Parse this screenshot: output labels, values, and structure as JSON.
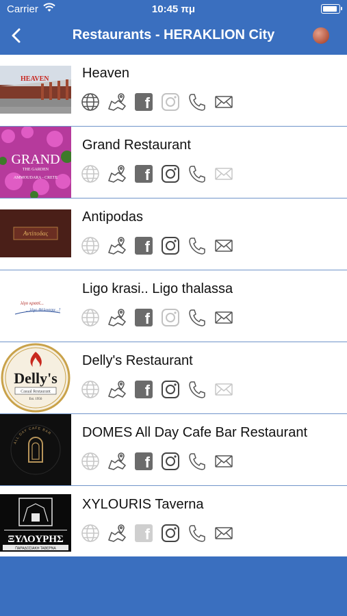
{
  "status": {
    "carrier": "Carrier",
    "time": "10:45 πμ"
  },
  "nav": {
    "title": "Restaurants - HERAKLION City"
  },
  "restaurants": [
    {
      "name": "Heaven",
      "thumb_text": "HEAVEN",
      "web": true,
      "map": true,
      "facebook": true,
      "instagram": false,
      "phone": true,
      "email": true
    },
    {
      "name": "Grand Restaurant",
      "thumb_text": "GRAND",
      "thumb_sub": "THE GARDEN",
      "thumb_sub2": "AMMOUDARA - CRETE",
      "web": false,
      "map": true,
      "facebook": true,
      "instagram": true,
      "phone": true,
      "email": false
    },
    {
      "name": "Antipodas",
      "thumb_text": "Αντίποδας",
      "web": false,
      "map": true,
      "facebook": true,
      "instagram": true,
      "phone": true,
      "email": true
    },
    {
      "name": "Ligo krasi.. Ligo thalassa",
      "thumb_text": "λίγο κρασί...",
      "thumb_sub": "...λίγο θάλασσα...!",
      "web": false,
      "map": true,
      "facebook": true,
      "instagram": false,
      "phone": true,
      "email": true
    },
    {
      "name": "Delly's Restaurant",
      "thumb_text": "Delly's",
      "thumb_sub": "Casual Restaurant",
      "thumb_sub2": "Est. 1956",
      "web": false,
      "map": true,
      "facebook": true,
      "instagram": true,
      "phone": true,
      "email": false
    },
    {
      "name": "DOMES All Day Cafe Bar Restaurant",
      "thumb_text": "ALL DAY CAFE BAR",
      "web": false,
      "map": true,
      "facebook": true,
      "instagram": true,
      "phone": true,
      "email": true
    },
    {
      "name": "XYLOURIS Taverna",
      "thumb_text": "ΞΥΛΟΥΡΗΣ",
      "thumb_sub": "ΠΑΡΑΔΟΣΙΑΚΗ ΤΑΒΕΡΝΑ",
      "web": false,
      "map": true,
      "facebook": false,
      "instagram": true,
      "phone": true,
      "email": true
    }
  ]
}
